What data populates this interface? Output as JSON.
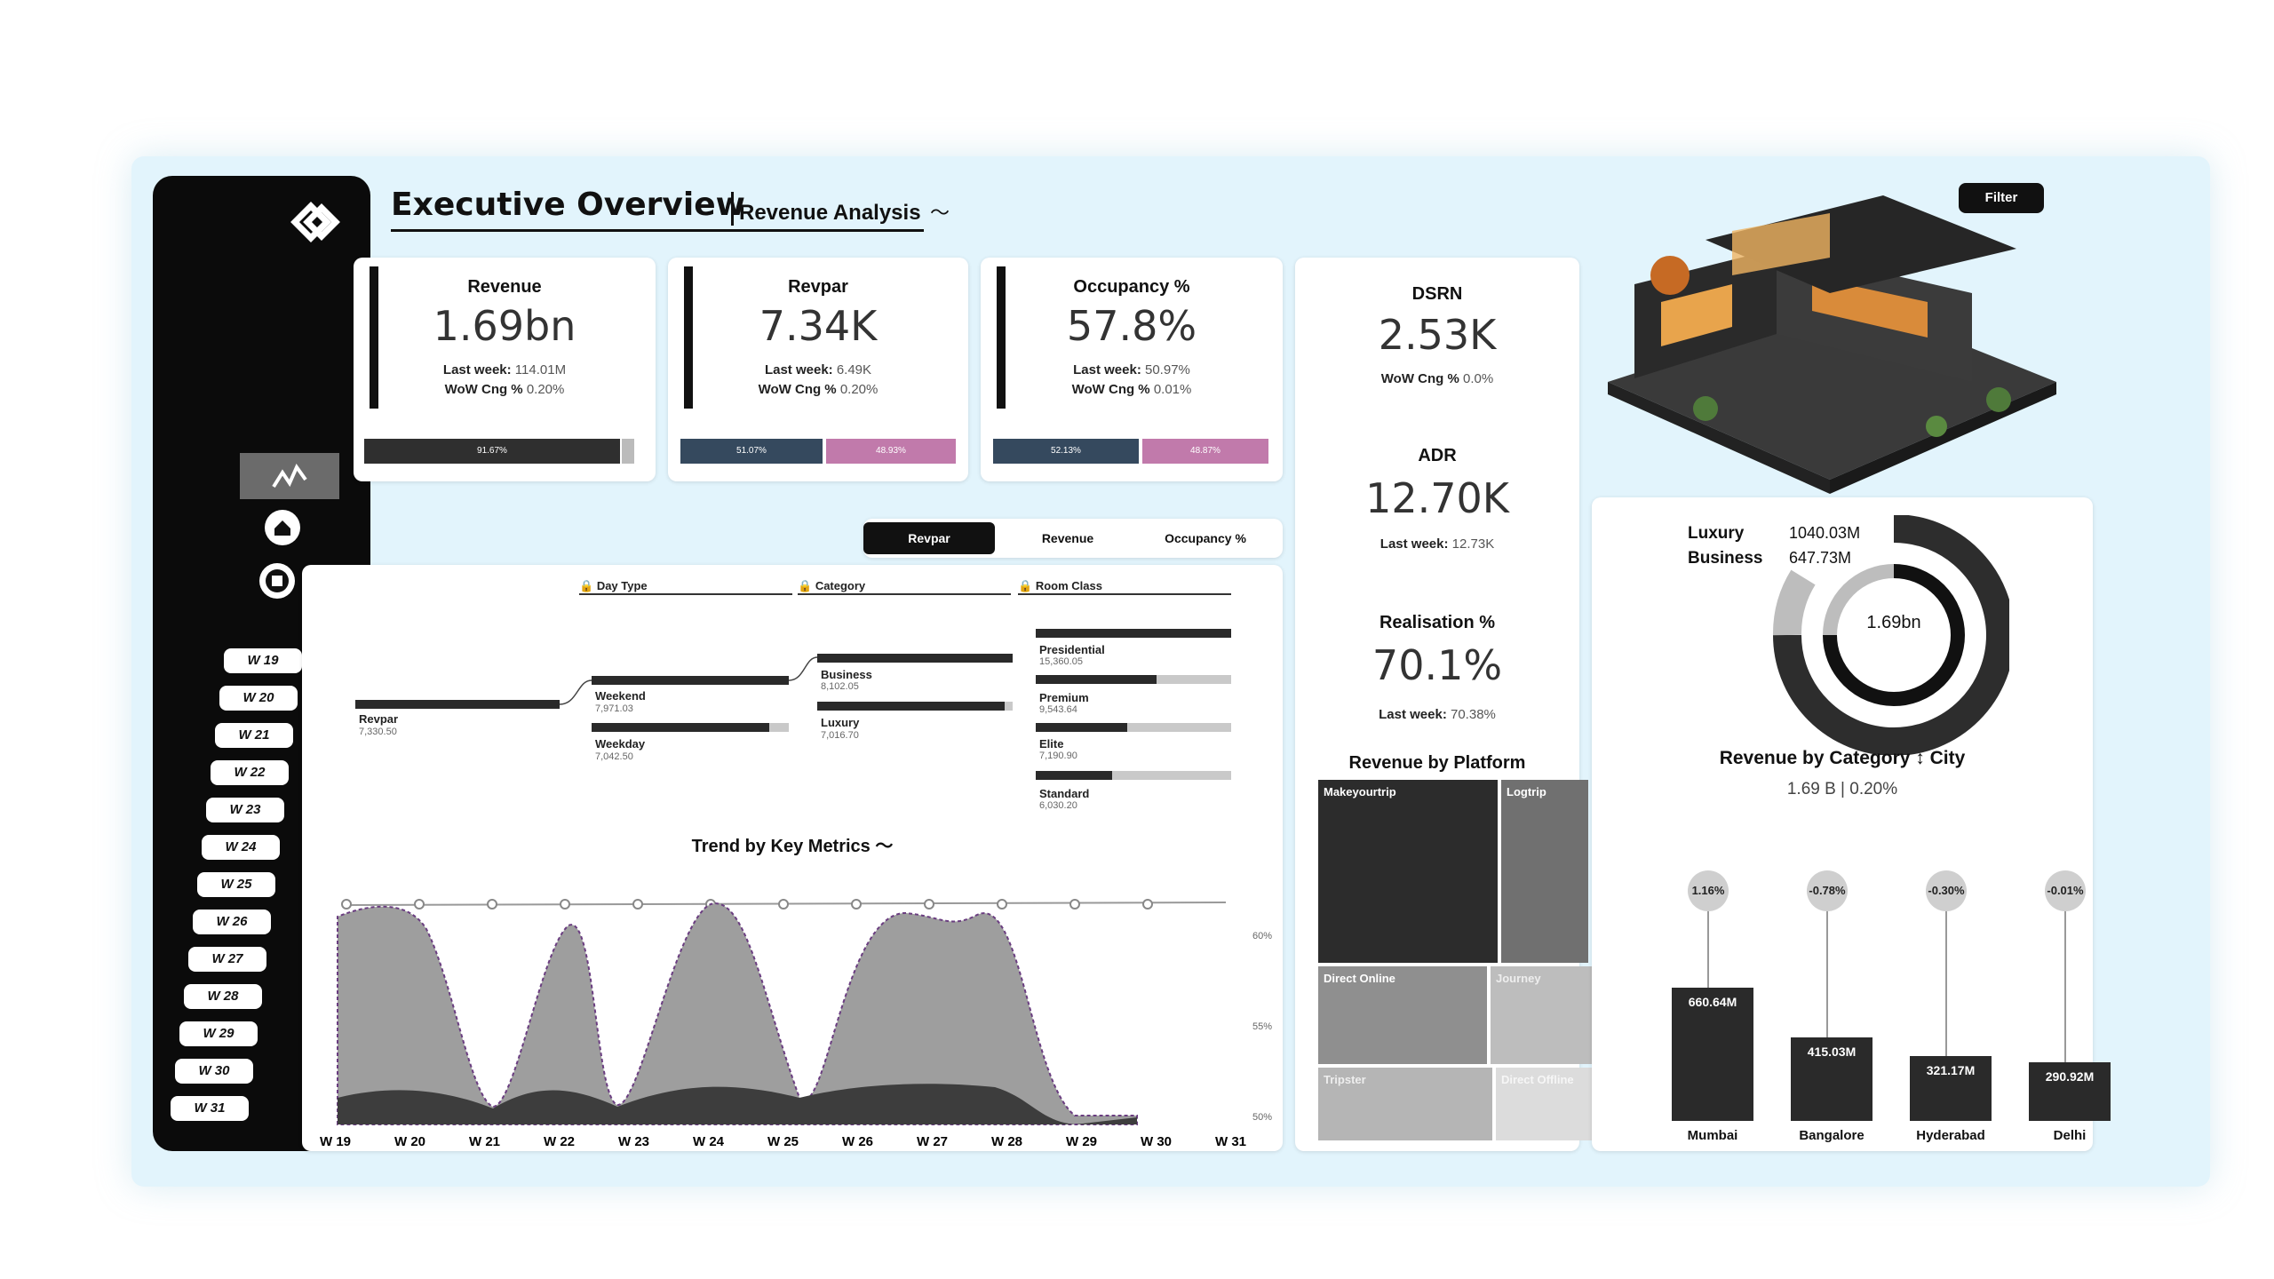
{
  "header": {
    "title": "Executive Overview",
    "subtitle": "Revenue Analysis",
    "filter_label": "Filter"
  },
  "sidebar": {
    "weeks": [
      "W 19",
      "W 20",
      "W 21",
      "W 22",
      "W 23",
      "W 24",
      "W 25",
      "W 26",
      "W 27",
      "W 28",
      "W 29",
      "W 30",
      "W 31"
    ]
  },
  "kpis": [
    {
      "title": "Revenue",
      "value": "1.69bn",
      "last_label": "Last week:",
      "last_value": "114.01M",
      "wow_label": "WoW Cng %",
      "wow_value": "0.20%",
      "bar1": "91.67%",
      "bar2": ""
    },
    {
      "title": "Revpar",
      "value": "7.34K",
      "last_label": "Last week:",
      "last_value": "6.49K",
      "wow_label": "WoW Cng %",
      "wow_value": "0.20%",
      "bar1": "51.07%",
      "bar2": "48.93%"
    },
    {
      "title": "Occupancy %",
      "value": "57.8%",
      "last_label": "Last week:",
      "last_value": "50.97%",
      "wow_label": "WoW Cng %",
      "wow_value": "0.01%",
      "bar1": "52.13%",
      "bar2": "48.87%"
    }
  ],
  "side_kpis": {
    "dsrn": {
      "title": "DSRN",
      "value": "2.53K",
      "sub_label": "WoW Cng %",
      "sub_value": "0.0%"
    },
    "adr": {
      "title": "ADR",
      "value": "12.70K",
      "sub_label": "Last week:",
      "sub_value": "12.73K"
    },
    "realisation": {
      "title": "Realisation %",
      "value": "70.1%",
      "sub_label": "Last week:",
      "sub_value": "70.38%"
    }
  },
  "tabs": [
    "Revpar",
    "Revenue",
    "Occupancy %"
  ],
  "decomp": {
    "headers": [
      "Day Type",
      "Category",
      "Room Class"
    ],
    "root": {
      "label": "Revpar",
      "value": "7,330.50"
    },
    "day_type": [
      {
        "label": "Weekend",
        "value": "7,971.03"
      },
      {
        "label": "Weekday",
        "value": "7,042.50"
      }
    ],
    "category": [
      {
        "label": "Business",
        "value": "8,102.05"
      },
      {
        "label": "Luxury",
        "value": "7,016.70"
      }
    ],
    "room_class": [
      {
        "label": "Presidential",
        "value": "15,360.05"
      },
      {
        "label": "Premium",
        "value": "9,543.64"
      },
      {
        "label": "Elite",
        "value": "7,190.90"
      },
      {
        "label": "Standard",
        "value": "6,030.20"
      }
    ]
  },
  "trend": {
    "title": "Trend by Key Metrics",
    "x_labels": [
      "W 19",
      "W 20",
      "W 21",
      "W 22",
      "W 23",
      "W 24",
      "W 25",
      "W 26",
      "W 27",
      "W 28",
      "W 29",
      "W 30",
      "W 31"
    ],
    "y_labels": [
      "60%",
      "55%",
      "50%"
    ]
  },
  "platform": {
    "title": "Revenue by Platform",
    "tiles": [
      "Makeyourtrip",
      "Logtrip",
      "Direct Online",
      "Journey",
      "Tripster",
      "Direct Offline"
    ]
  },
  "donut": {
    "center": "1.69bn",
    "legend": [
      {
        "name": "Luxury",
        "value": "1040.03M"
      },
      {
        "name": "Business",
        "value": "647.73M"
      }
    ],
    "title": "Revenue by Category",
    "title_suffix": "City",
    "subtitle": "1.69 B | 0.20%"
  },
  "cities": [
    {
      "name": "Mumbai",
      "value": "660.64M",
      "pct": "1.16%",
      "amount": 660.64
    },
    {
      "name": "Bangalore",
      "value": "415.03M",
      "pct": "-0.78%",
      "amount": 415.03
    },
    {
      "name": "Hyderabad",
      "value": "321.17M",
      "pct": "-0.30%",
      "amount": 321.17
    },
    {
      "name": "Delhi",
      "value": "290.92M",
      "pct": "-0.01%",
      "amount": 290.92
    }
  ],
  "colors": {
    "dark": "#2f2f2f",
    "slate": "#35495e",
    "pink": "#c17aab",
    "panel": "#e2f4fc"
  }
}
